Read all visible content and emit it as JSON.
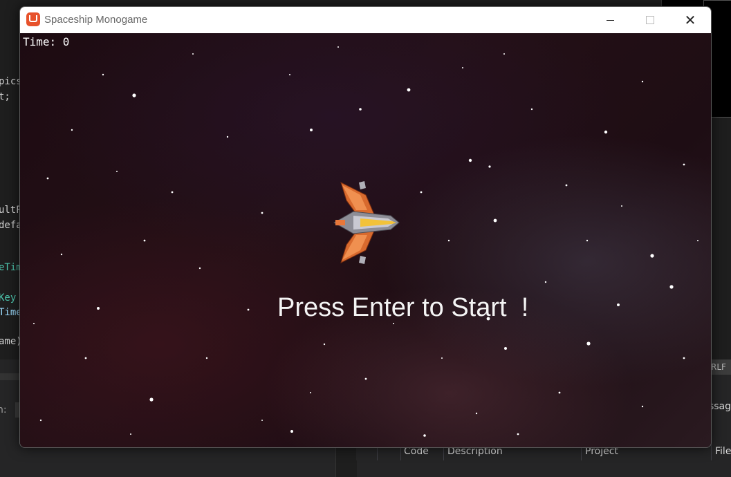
{
  "ide": {
    "code_fragments": [
      "pics",
      "t;",
      "ultP",
      "defa",
      "eTim",
      "Key",
      "Time",
      "ame)"
    ],
    "search_label": "h:",
    "line_ending": "RLF",
    "message_fragment": "essag",
    "error_list_columns": [
      "Code",
      "Description",
      "Project",
      "File"
    ]
  },
  "window": {
    "title": "Spaceship Monogame",
    "app_icon": "monogame-logo-icon",
    "controls": [
      "minimize-icon",
      "maximize-icon",
      "close-icon"
    ],
    "close_glyph": "✕"
  },
  "game": {
    "time_label": "Time: 0",
    "prompt": "Press Enter to Start  !",
    "player_sprite": "spaceship-icon",
    "colors": {
      "sky": "#1d0b12",
      "text": "#f4f4f4",
      "ship_orange": "#e8773a",
      "ship_gold": "#f2c23a"
    }
  }
}
